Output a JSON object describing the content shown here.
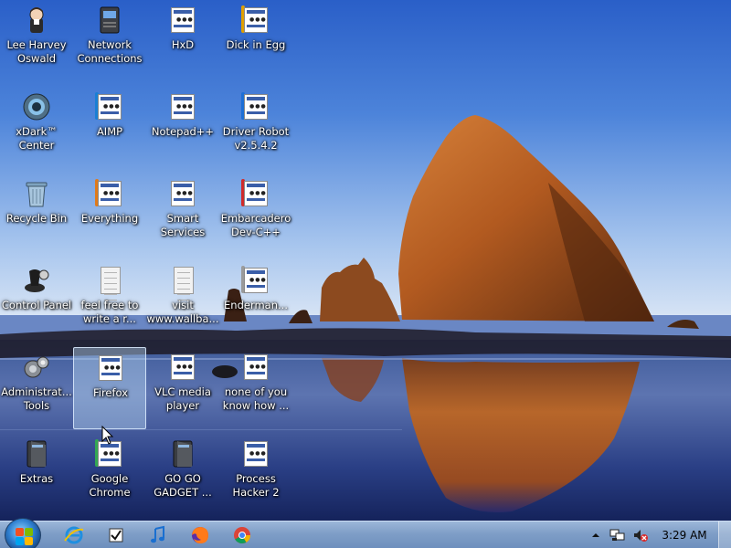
{
  "desktop": {
    "icons": [
      {
        "label": "Lee Harvey\nOswald",
        "icon": "person-icon"
      },
      {
        "label": "Network\nConnections",
        "icon": "network-icon"
      },
      {
        "label": "HxD",
        "icon": "app-icon"
      },
      {
        "label": "Dick in Egg",
        "icon": "app-icon"
      },
      {
        "label": "xDark™ Center",
        "icon": "speaker-icon"
      },
      {
        "label": "AIMP",
        "icon": "app-icon"
      },
      {
        "label": "Notepad++",
        "icon": "app-icon"
      },
      {
        "label": "Driver Robot\nv2.5.4.2",
        "icon": "app-icon"
      },
      {
        "label": "Recycle Bin",
        "icon": "recycle-bin-icon"
      },
      {
        "label": "Everything",
        "icon": "app-icon"
      },
      {
        "label": "Smart Services",
        "icon": "app-icon"
      },
      {
        "label": "Embarcadero\nDev-C++",
        "icon": "app-icon"
      },
      {
        "label": "Control Panel",
        "icon": "control-panel-icon"
      },
      {
        "label": "feel free to\nwrite a r...",
        "icon": "document-icon"
      },
      {
        "label": "visit\nwww.wallba...",
        "icon": "document-icon"
      },
      {
        "label": "Enderman...",
        "icon": "app-icon"
      },
      {
        "label": "Administrat...\nTools",
        "icon": "admin-tools-icon"
      },
      {
        "label": "Firefox",
        "icon": "app-icon"
      },
      {
        "label": "VLC media\nplayer",
        "icon": "app-icon"
      },
      {
        "label": "none of you\nknow how ...",
        "icon": "app-icon"
      },
      {
        "label": "Extras",
        "icon": "folder-icon"
      },
      {
        "label": "Google\nChrome",
        "icon": "app-icon"
      },
      {
        "label": "GO GO\nGADGET ...",
        "icon": "folder-icon"
      },
      {
        "label": "Process\nHacker 2",
        "icon": "app-icon"
      }
    ],
    "selected_icon": "Firefox"
  },
  "taskbar": {
    "pinned": [
      {
        "name": "Internet Explorer",
        "icon": "ie-icon"
      },
      {
        "name": "Checklist",
        "icon": "checkbox-icon"
      },
      {
        "name": "Music",
        "icon": "music-note-icon"
      },
      {
        "name": "Firefox",
        "icon": "firefox-icon"
      },
      {
        "name": "Chrome",
        "icon": "chrome-icon"
      }
    ],
    "tray": {
      "icons": [
        "show-hidden-icons-icon",
        "network-tray-icon",
        "volume-muted-icon"
      ],
      "clock": "3:29 AM"
    }
  },
  "colors": {
    "sky_top": "#2a63c9",
    "sky_mid": "#6c9be0",
    "sky_horizon": "#cfe0f5",
    "rock": "#b85a22",
    "water_dark": "#1a2c6a",
    "taskbar": "#7f9ec7"
  }
}
